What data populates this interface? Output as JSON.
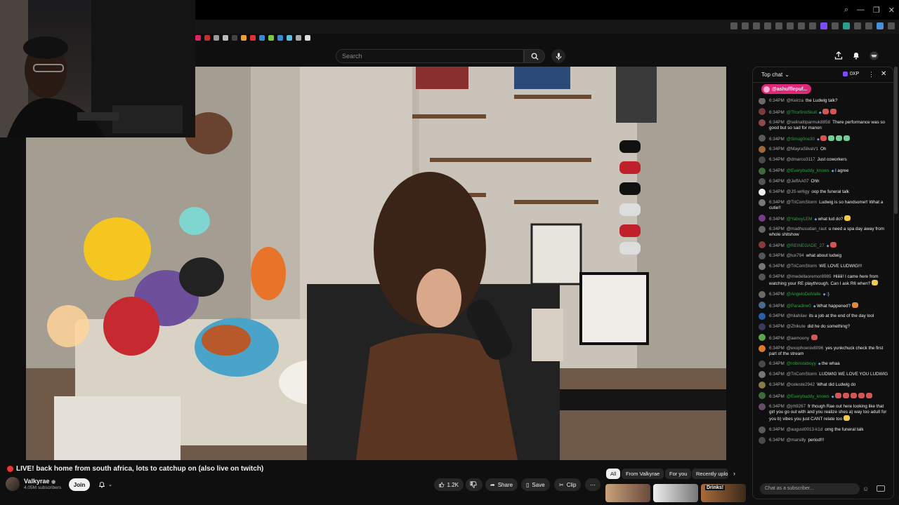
{
  "browser": {
    "window_buttons": [
      "—",
      "❐",
      "✕"
    ]
  },
  "youtube": {
    "search_placeholder": "Search"
  },
  "video": {
    "title": "LIVE! back home from south africa, lots to catchup on (also live on twitch)",
    "channel_name": "Valkyrae",
    "subscribers": "4.05M subscribers",
    "join_label": "Join",
    "like_count": "1.2K",
    "share_label": "Share",
    "save_label": "Save",
    "clip_label": "Clip"
  },
  "chips": [
    "All",
    "From Valkyrae",
    "For you",
    "Recently uplo"
  ],
  "thumb_label": "Drinks!",
  "chat": {
    "header": "Top chat",
    "points": "0XP",
    "pinned_user": "@ashufflepuf...",
    "input_placeholder": "Chat as a subscriber...",
    "messages": [
      {
        "time": "6:34PM",
        "author": "@Keirza",
        "text": "the Ludwig talk?",
        "member": false,
        "color": "#6a6a6a"
      },
      {
        "time": "6:34PM",
        "author": "@ThorfinnSkull",
        "text": "",
        "member": true,
        "color": "#7a3b3b",
        "emoji": [
          "#d45555",
          "#d45555"
        ]
      },
      {
        "time": "6:34PM",
        "author": "@selinaltiparmuk8858",
        "text": "There performance was so good but so sad for manon",
        "member": false,
        "color": "#8a4a4a"
      },
      {
        "time": "6:34PM",
        "author": "@Smug0ne30",
        "text": "",
        "member": true,
        "color": "#5a5a5a",
        "emoji": [
          "#d45555",
          "#6fcf97",
          "#6fcf97",
          "#6fcf97"
        ]
      },
      {
        "time": "6:34PM",
        "author": "@MayraSilvaV1",
        "text": "Oh",
        "member": false,
        "color": "#9c6a3a"
      },
      {
        "time": "6:34PM",
        "author": "@dmarco3117",
        "text": "Just coworkers",
        "member": false,
        "color": "#4a4a4a"
      },
      {
        "time": "6:34PM",
        "author": "@Everybuddy_knows",
        "text": "I agree",
        "member": true,
        "color": "#3e6b3e"
      },
      {
        "time": "6:34PM",
        "author": "@JeffAA07",
        "text": "Ohh",
        "member": false,
        "color": "#555"
      },
      {
        "time": "6:34PM",
        "author": "@JS-wr6gy",
        "text": "oop the funeral talk",
        "member": false,
        "color": "#eee"
      },
      {
        "time": "6:34PM",
        "author": "@TriComStorm",
        "text": "Ludwig is so handsome!! What a cutie!!",
        "member": false,
        "color": "#777"
      },
      {
        "time": "6:34PM",
        "author": "@YaboyLEM",
        "text": "what lud do?",
        "member": true,
        "color": "#7a3a8a",
        "emoji": [
          "#f2c94c"
        ]
      },
      {
        "time": "6:34PM",
        "author": "@madhusudan_raut",
        "text": "u need a spa day away from whole shitshow",
        "member": false,
        "color": "#666"
      },
      {
        "time": "6:34PM",
        "author": "@REINEGADE_27",
        "text": "",
        "member": true,
        "color": "#8a3a3a",
        "emoji": [
          "#d45555"
        ]
      },
      {
        "time": "6:34PM",
        "author": "@lux794",
        "text": "what about ludwig",
        "member": false,
        "color": "#555"
      },
      {
        "time": "6:34PM",
        "author": "@TriComStorm",
        "text": "WE LOVE LUDWIG!!!",
        "member": false,
        "color": "#777"
      },
      {
        "time": "6:34PM",
        "author": "@imedellaoremor8985",
        "text": "Hiiiiii! I came here from watching your RE playthrough. Can I ask R6 when?",
        "member": false,
        "color": "#555",
        "emoji": [
          "#f2c94c"
        ]
      },
      {
        "time": "6:34PM",
        "author": "@AngeloDelValle",
        "text": ":)",
        "member": true,
        "color": "#6a6a6a"
      },
      {
        "time": "6:34PM",
        "author": "@Paradine0",
        "text": "What happened?",
        "member": true,
        "color": "#4a6a8a",
        "emoji": [
          "#e08a3a"
        ]
      },
      {
        "time": "6:34PM",
        "author": "@hilahilav",
        "text": "its a job at the end of the day lool",
        "member": false,
        "color": "#2a5fa8"
      },
      {
        "time": "6:34PM",
        "author": "@Zhikute",
        "text": "did he do something?",
        "member": false,
        "color": "#3a3a5a"
      },
      {
        "time": "6:34PM",
        "author": "@aemoony",
        "text": "",
        "member": false,
        "color": "#5aa84a",
        "emoji": [
          "#d45555"
        ]
      },
      {
        "time": "6:34PM",
        "author": "@exophoenix8096",
        "text": "yes yunkchuck check the first part of the stream",
        "member": false,
        "color": "#e07a2a"
      },
      {
        "time": "6:34PM",
        "author": "@robinstaboyy",
        "text": "the whaa",
        "member": true,
        "color": "#4a4a4a"
      },
      {
        "time": "6:34PM",
        "author": "@TriComStorm",
        "text": "LUDWIG WE LOVE YOU LUDWIG",
        "member": false,
        "color": "#777"
      },
      {
        "time": "6:34PM",
        "author": "@celeste2942",
        "text": "What did Ludwig do",
        "member": false,
        "color": "#8a7a4a"
      },
      {
        "time": "6:34PM",
        "author": "@Everybuddy_knows",
        "text": "",
        "member": true,
        "color": "#3e6b3e",
        "emoji": [
          "#d45555",
          "#d45555",
          "#d45555",
          "#d45555",
          "#d45555"
        ]
      },
      {
        "time": "6:34PM",
        "author": "@jrh9267",
        "text": "fr though Rae out here looking like that girl you go out with and you realize shes a) way too adult for you b) vibes you just CANT relate too",
        "member": false,
        "color": "#6a4a6a",
        "emoji": [
          "#f2c94c"
        ]
      },
      {
        "time": "6:34PM",
        "author": "@august0013-k1d",
        "text": "omg the funeral talk",
        "member": false,
        "color": "#5a5a5a"
      },
      {
        "time": "6:34PM",
        "author": "@marsilly",
        "text": "period!!!",
        "member": false,
        "color": "#4a4a4a"
      }
    ]
  },
  "colors": {
    "background": "#0f0f0f",
    "member_name": "#2ba640",
    "live_red": "#e33333",
    "pinned_pink": "#e0287a"
  }
}
